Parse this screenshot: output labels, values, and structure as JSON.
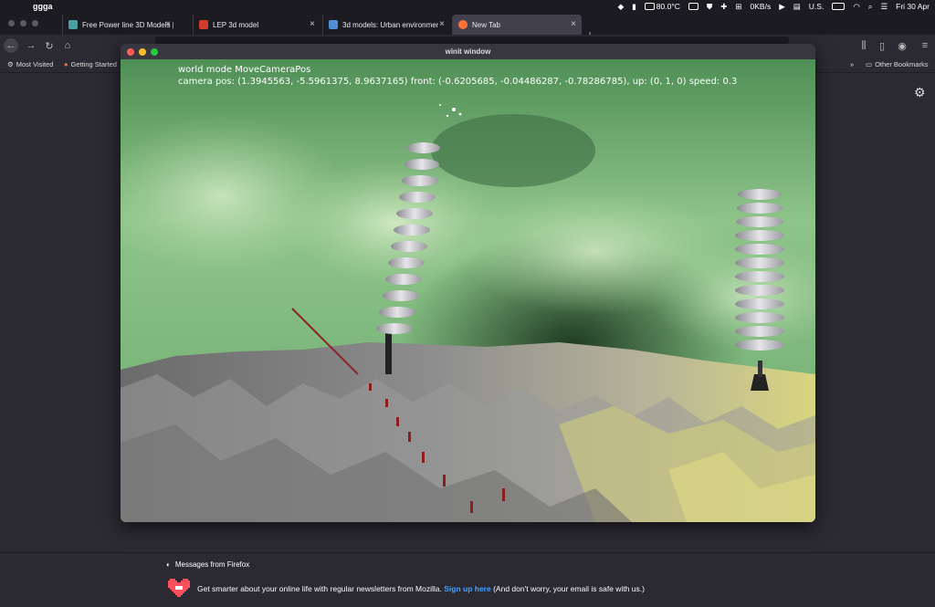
{
  "menubar": {
    "app_name": "ggga",
    "temperature": "80.0°C",
    "network": "0KB/s",
    "input_source": "U.S.",
    "datetime": "Fri 30 Apr"
  },
  "tabs": [
    {
      "label": "Free Power line 3D Models | CG",
      "favicon": "cg"
    },
    {
      "label": "LEP 3d model",
      "favicon": "3d"
    },
    {
      "label": "3d models: Urban environment",
      "favicon": "S"
    },
    {
      "label": "New Tab",
      "favicon": "firefox"
    }
  ],
  "bookmarks": {
    "most_visited": "Most Visited",
    "getting_started": "Getting Started",
    "other": "Other Bookmarks"
  },
  "winit": {
    "title": "winit window",
    "line1": "world mode MoveCameraPos",
    "line2": "camera pos: (1.3945563, -5.5961375, 8.9637165) front: (-0.6205685, -0.04486287, -0.78286785), up: (0, 1, 0) speed: 0.3"
  },
  "messages": {
    "title": "Messages from Firefox",
    "body": "Get smarter about your online life with regular newsletters from Mozilla.",
    "link": "Sign up here",
    "tail": "(And don't worry, your email is safe with us.)"
  },
  "colors": {
    "sky_green": "#7fb57a",
    "ground_grey": "#8a8a8a",
    "ground_yellow": "#d6d27a",
    "accent_link": "#45a1ff"
  }
}
